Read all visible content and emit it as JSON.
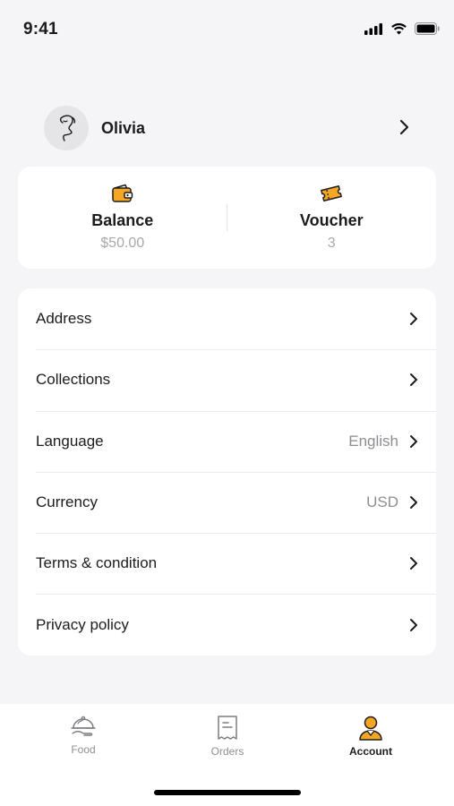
{
  "status_bar": {
    "time": "9:41",
    "icons": [
      "signal-icon",
      "wifi-icon",
      "battery-icon"
    ]
  },
  "profile": {
    "name": "Olivia"
  },
  "wallet": {
    "balance": {
      "title": "Balance",
      "value": "$50.00",
      "icon": "wallet-icon"
    },
    "voucher": {
      "title": "Voucher",
      "value": "3",
      "icon": "ticket-icon"
    }
  },
  "menu": {
    "items": [
      {
        "label": "Address",
        "value": ""
      },
      {
        "label": "Collections",
        "value": ""
      },
      {
        "label": "Language",
        "value": "English"
      },
      {
        "label": "Currency",
        "value": "USD"
      },
      {
        "label": "Terms & condition",
        "value": ""
      },
      {
        "label": "Privacy policy",
        "value": ""
      }
    ]
  },
  "tabbar": {
    "tabs": [
      {
        "label": "Food",
        "icon": "cloche-icon"
      },
      {
        "label": "Orders",
        "icon": "receipt-icon"
      },
      {
        "label": "Account",
        "icon": "user-icon",
        "active": true
      }
    ]
  },
  "colors": {
    "accent": "#f5a623",
    "background": "#f5f5f7",
    "card": "#ffffff",
    "muted_text": "#a9a9ad"
  }
}
